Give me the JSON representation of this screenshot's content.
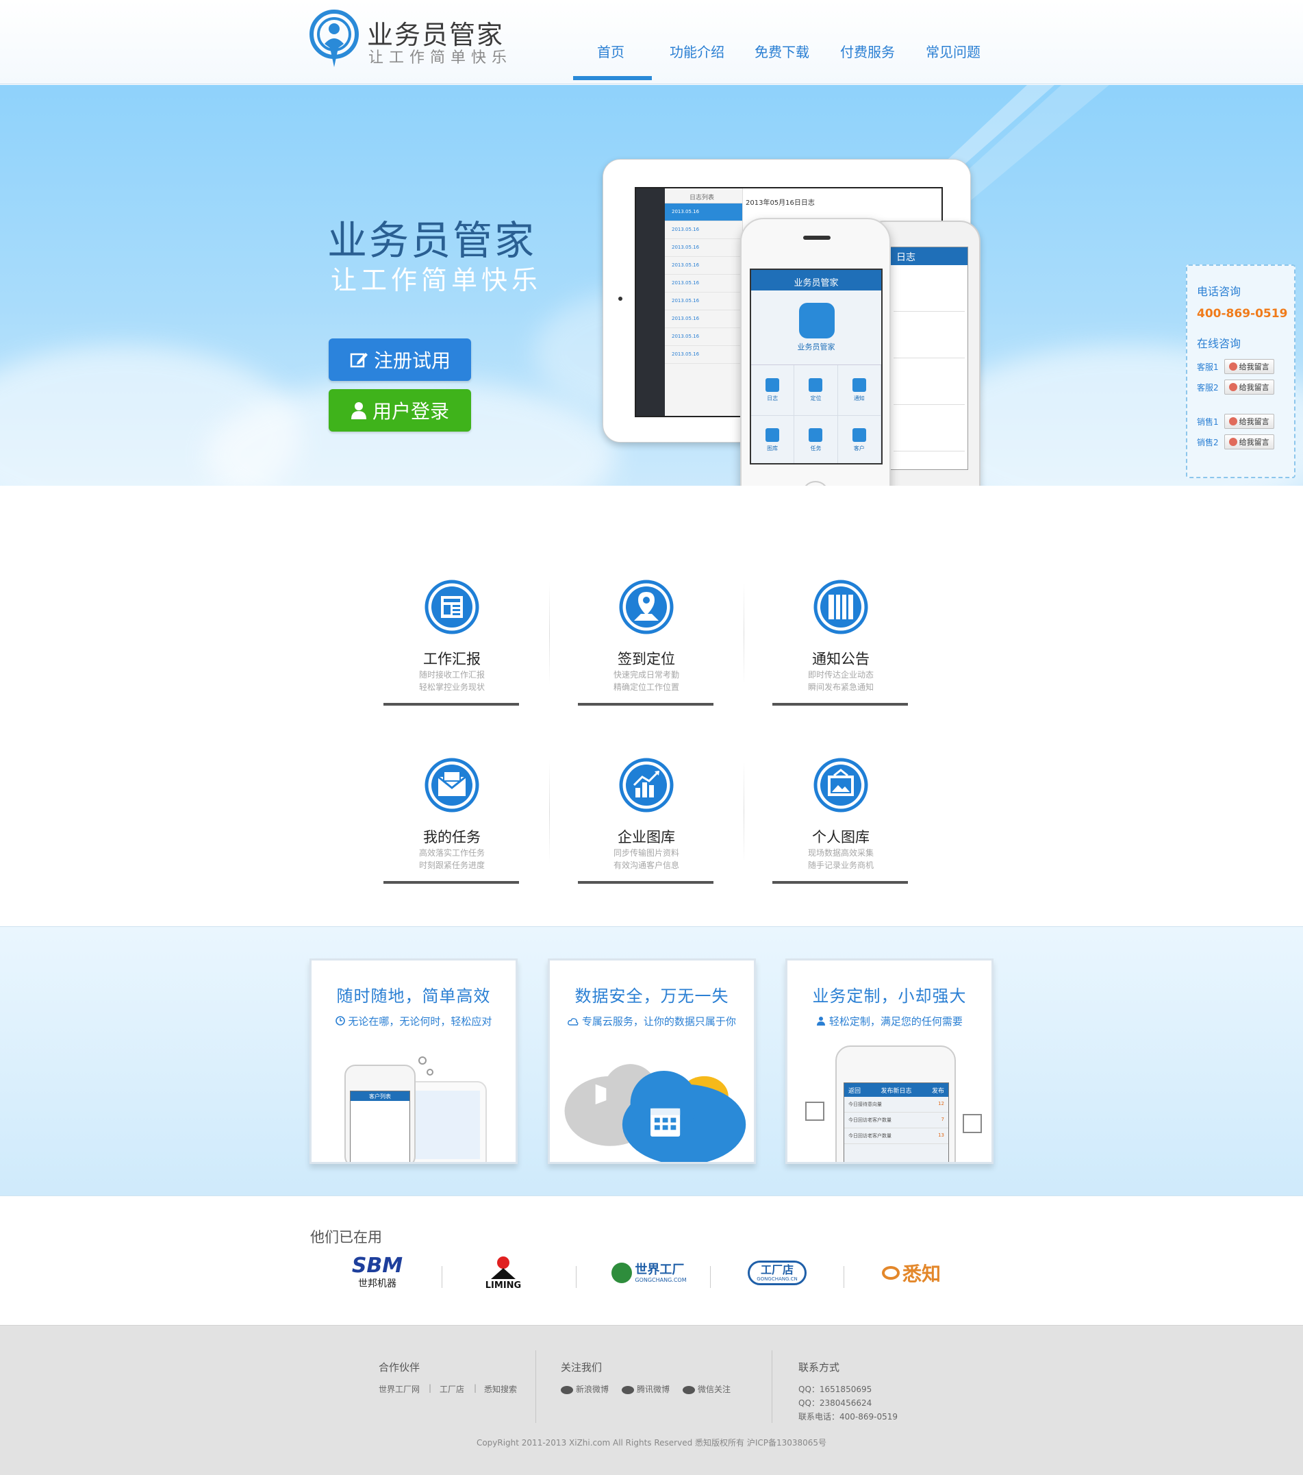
{
  "header": {
    "logo_title": "业务员管家",
    "logo_sub": "让工作简单快乐",
    "nav": [
      "首页",
      "功能介绍",
      "免费下载",
      "付费服务",
      "常见问题"
    ],
    "active_nav": "首页"
  },
  "hero": {
    "title": "业务员管家",
    "subtitle": "让工作简单快乐",
    "register_label": "注册试用",
    "login_label": "用户登录",
    "tablet": {
      "list_title": "日志列表",
      "main_title": "2013年05月16日日志",
      "rows": [
        "2013.05.16",
        "2013.05.16",
        "2013.05.16",
        "2013.05.16",
        "2013.05.16",
        "2013.05.16",
        "2013.05.16",
        "2013.05.16",
        "2013.05.16"
      ]
    },
    "phone_front": {
      "header": "业务员管家",
      "app_name": "业务员管家",
      "grid": [
        "日志",
        "定位",
        "通知",
        "图库",
        "任务",
        "客户"
      ]
    },
    "phone_back": {
      "header": "日志"
    }
  },
  "consult": {
    "phone_title": "电话咨询",
    "phone": "400-869-0519",
    "online_title": "在线咨询",
    "button_label": "给我留言",
    "agents": [
      "客服1",
      "客服2",
      "销售1",
      "销售2"
    ]
  },
  "features": [
    {
      "title": "工作汇报",
      "desc1": "随时接收工作汇报",
      "desc2": "轻松掌控业务现状",
      "icon": "report-icon"
    },
    {
      "title": "签到定位",
      "desc1": "快速完成日常考勤",
      "desc2": "精确定位工作位置",
      "icon": "location-icon"
    },
    {
      "title": "通知公告",
      "desc1": "即时传达企业动态",
      "desc2": "瞬间发布紧急通知",
      "icon": "notice-icon"
    },
    {
      "title": "我的任务",
      "desc1": "高效落实工作任务",
      "desc2": "时刻跟紧任务进度",
      "icon": "task-icon"
    },
    {
      "title": "企业图库",
      "desc1": "同步传输图片资料",
      "desc2": "有效沟通客户信息",
      "icon": "chart-icon"
    },
    {
      "title": "个人图库",
      "desc1": "现场数据高效采集",
      "desc2": "随手记录业务商机",
      "icon": "gallery-icon"
    }
  ],
  "values": [
    {
      "title": "随时随地，简单高效",
      "sub": "无论在哪，无论何时，轻松应对",
      "icon": "clock-icon"
    },
    {
      "title": "数据安全，万无一失",
      "sub": "专属云服务，让你的数据只属于你",
      "icon": "cloud-icon"
    },
    {
      "title": "业务定制，小却强大",
      "sub": "轻松定制，满足您的任何需要",
      "icon": "user-icon"
    }
  ],
  "value_art": {
    "phone_header_1": "客户列表",
    "phone_header_3": "发布新日志",
    "back": "返回",
    "publish": "发布",
    "rows3": [
      "今日接待意向量",
      "今日回访老客户数量",
      "今日回访老客户数量"
    ],
    "vals3": [
      "12",
      "7",
      "13"
    ]
  },
  "clients": {
    "title": "他们已在用",
    "logos": [
      {
        "name": "SBM",
        "sub": "世邦机器"
      },
      {
        "name": "",
        "sub": "LIMING"
      },
      {
        "name": "世界工厂",
        "sub": "GONGCHANG.COM"
      },
      {
        "name": "工厂店",
        "sub": "GONGCHANG.CN"
      },
      {
        "name": "悉知",
        "sub": ""
      }
    ]
  },
  "footer": {
    "partners_title": "合作伙伴",
    "partners": [
      "世界工厂网",
      "工厂店",
      "悉知搜索"
    ],
    "follow_title": "关注我们",
    "follow": [
      "新浪微博",
      "腾讯微博",
      "微信关注"
    ],
    "contact_title": "联系方式",
    "contact": [
      "QQ：1651850695",
      "QQ：2380456624",
      "联系电话：400-869-0519"
    ],
    "copyright": "CopyRight 2011-2013 XiZhi.com All Rights Reserved 悉知版权所有 沪ICP备13038065号"
  },
  "colors": {
    "primary": "#2a7fd3",
    "green": "#3fb31b",
    "orange": "#f07b1a"
  }
}
